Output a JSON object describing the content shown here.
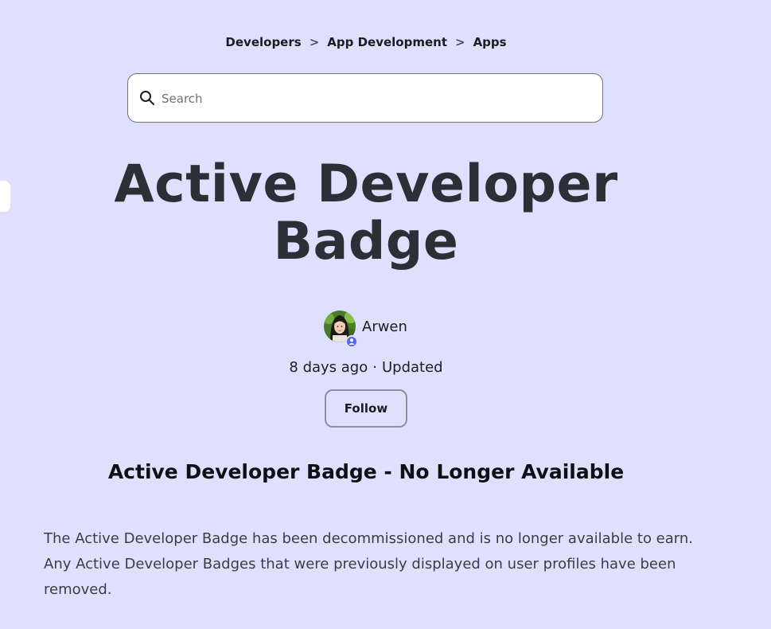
{
  "breadcrumb": {
    "items": [
      {
        "label": "Developers"
      },
      {
        "label": "App Development"
      },
      {
        "label": "Apps"
      }
    ],
    "separator": ">"
  },
  "search": {
    "placeholder": "Search",
    "value": ""
  },
  "article": {
    "title": "Active Developer Badge",
    "author": {
      "name": "Arwen",
      "avatar_icon": "user-avatar",
      "badge_icon": "community-member-icon"
    },
    "meta": {
      "time": "8 days ago",
      "separator": "·",
      "status": "Updated"
    },
    "follow_label": "Follow",
    "section_heading": "Active Developer Badge - No Longer Available",
    "body": "The Active Developer Badge has been decommissioned and is no longer available to earn. Any Active Developer Badges that were previously displayed on user profiles have been removed."
  },
  "colors": {
    "background": "#dfe0fd",
    "accent": "#5865f2",
    "title": "#2b2f36"
  }
}
